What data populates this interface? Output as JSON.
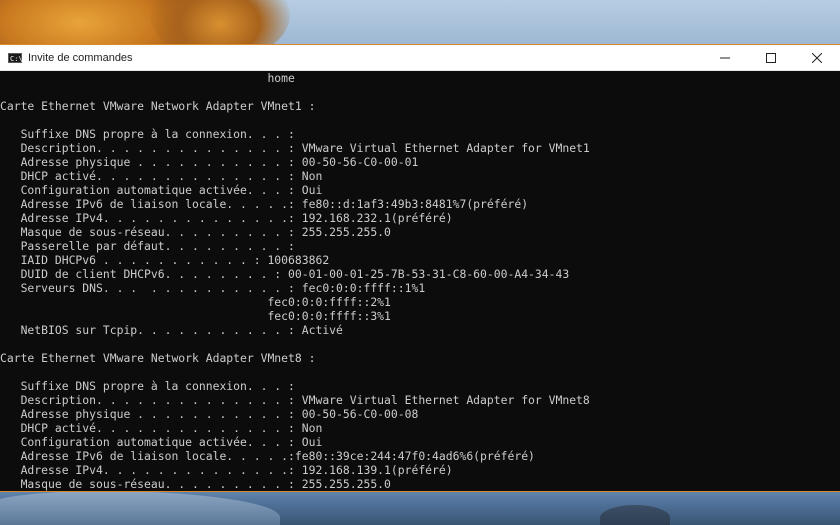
{
  "window": {
    "title": "Invite de commandes",
    "icon_text": "C:\\",
    "buttons": {
      "minimize": "minimize-icon",
      "maximize": "maximize-icon",
      "close": "close-icon"
    }
  },
  "console": {
    "lines": [
      "                                       home",
      "",
      "Carte Ethernet VMware Network Adapter VMnet1 :",
      "",
      "   Suffixe DNS propre à la connexion. . . :",
      "   Description. . . . . . . . . . . . . . : VMware Virtual Ethernet Adapter for VMnet1",
      "   Adresse physique . . . . . . . . . . . : 00-50-56-C0-00-01",
      "   DHCP activé. . . . . . . . . . . . . . : Non",
      "   Configuration automatique activée. . . : Oui",
      "   Adresse IPv6 de liaison locale. . . . .: fe80::d:1af3:49b3:8481%7(préféré)",
      "   Adresse IPv4. . . . . . . . . . . . . .: 192.168.232.1(préféré)",
      "   Masque de sous-réseau. . . . . . . . . : 255.255.255.0",
      "   Passerelle par défaut. . . . . . . . . :",
      "   IAID DHCPv6 . . . . . . . . . . . : 100683862",
      "   DUID de client DHCPv6. . . . . . . . : 00-01-00-01-25-7B-53-31-C8-60-00-A4-34-43",
      "   Serveurs DNS. . .  . . . . . . . . . . : fec0:0:0:ffff::1%1",
      "                                       fec0:0:0:ffff::2%1",
      "                                       fec0:0:0:ffff::3%1",
      "   NetBIOS sur Tcpip. . . . . . . . . . . : Activé",
      "",
      "Carte Ethernet VMware Network Adapter VMnet8 :",
      "",
      "   Suffixe DNS propre à la connexion. . . :",
      "   Description. . . . . . . . . . . . . . : VMware Virtual Ethernet Adapter for VMnet8",
      "   Adresse physique . . . . . . . . . . . : 00-50-56-C0-00-08",
      "   DHCP activé. . . . . . . . . . . . . . : Non",
      "   Configuration automatique activée. . . : Oui",
      "   Adresse IPv6 de liaison locale. . . . .:fe80::39ce:244:47f0:4ad6%6(préféré)",
      "   Adresse IPv4. . . . . . . . . . . . . .: 192.168.139.1(préféré)",
      "   Masque de sous-réseau. . . . . . . . . : 255.255.255.0"
    ]
  },
  "colors": {
    "console_bg": "#0c0c0c",
    "console_fg": "#cccccc",
    "window_border": "#d9892a",
    "titlebar_bg": "#ffffff"
  }
}
